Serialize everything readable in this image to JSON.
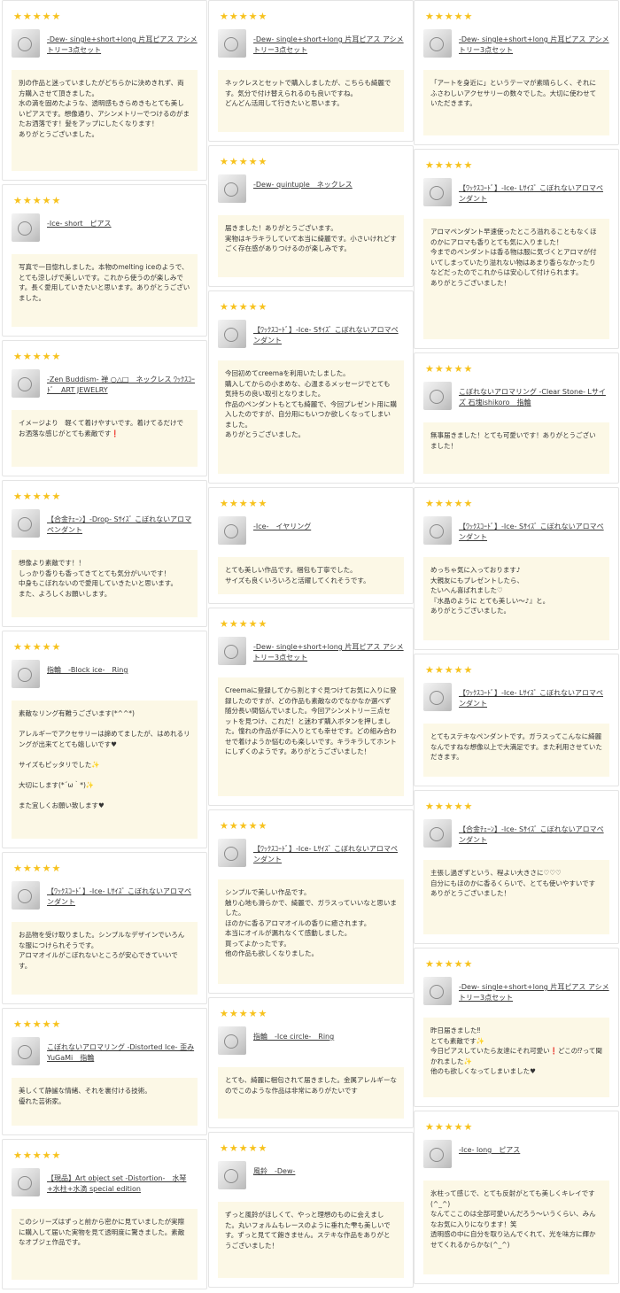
{
  "columns": [
    [
      {
        "stars": "★★★★★",
        "product": "-Dew- single+short+long 片耳ピアス アシメトリー3点セット",
        "review": "別の作品と迷っていましたがどちらかに決めきれず、両方購入させて頂きました。\n水の滴を固めたような、透明感もきらめきもとても美しいピアスです。想像通り、アシンメトリーでつけるのがまたお洒落です！髪をアップにしたくなります！\nありがとうございました。"
      },
      {
        "stars": "★★★★★",
        "product": "-Ice- short　ピアス",
        "review": "写真で一目惚れしました。本物のmelting iceのようで、とても涼しげで美しいです。これから使うのが楽しみです。長く愛用していきたいと思います。ありがとうございました。"
      },
      {
        "stars": "★★★★★",
        "product": "-Zen Buddism- 禅 ○△□　ネックレス ﾜｯｸｽｺｰﾄﾞ　ART JEWELRY",
        "review": "イメージより　軽くて着けやすいです。着けてるだけで　お洒落な感じがとても素敵です❗"
      },
      {
        "stars": "★★★★★",
        "product": "【合金ﾁｪｰﾝ】-Drop- Sｻｲｽﾞ こぼれないアロマペンダント",
        "review": "想像より素敵です！！\nしっかり香りも香ってきてとても気分がいいです！\n中身もこぼれないので愛用していきたいと思います。\nまた、よろしくお願いします。"
      },
      {
        "stars": "★★★★★",
        "product": "指輪　-Block ice-　Ring",
        "review": "素敵なリング有難うございます(*^^*)\n\nアレルギーでアクセサリーは諦めてましたが、はめれるリングが出来てとても嬉しいです♥\n\nサイズもピッタリでした✨\n\n大切にします(*´ω｀*)✨\n\nまた宜しくお願い致します♥"
      },
      {
        "stars": "★★★★★",
        "product": "【ﾜｯｸｽｺｰﾄﾞ】-Ice- Lｻｲｽﾞ こぼれないアロマペンダント",
        "review": "お品物を受け取りました。シンプルなデザインでいろんな服につけられそうです。\nアロマオイルがこぼれないところが安心できていいです。"
      },
      {
        "stars": "★★★★★",
        "product": "こぼれないアロマリング -Distorted Ice- 歪みYuGaMi　指輪",
        "review": "美しくて静謐な情緒、それを裏付ける技術。\n優れた芸術家。"
      },
      {
        "stars": "★★★★★",
        "product": "【現品】Art object set -Distortion-　水琴+水柱+水滴 special edition",
        "review": "このシリーズはずっと前から密かに見ていましたが実際に購入して届いた実物を見て透明度に驚きました。素敵なオブジェ作品です。"
      }
    ],
    [
      {
        "stars": "★★★★★",
        "product": "-Dew- single+short+long 片耳ピアス アシメトリー3点セット",
        "review": "ネックレスとセットで購入しましたが、こちらも綺麗です。気分で付け替えられるのも良いですね。\nどんどん活用して行きたいと思います。"
      },
      {
        "stars": "★★★★★",
        "product": "-Dew- quintuple　ネックレス",
        "review": "届きました！ありがとうございます。\n実物はキラキラしていて本当に綺麗です。小さいけれどすごく存在感がありつけるのが楽しみです。"
      },
      {
        "stars": "★★★★★",
        "product": "【ﾜｯｸｽｺｰﾄﾞ】-Ice- Sｻｲｽﾞ こぼれないアロマペンダント",
        "review": "今回初めてcreemaを利用いたしました。\n購入してからの小まめな、心温まるメッセージでとても気持ちの良い取引となりました。\n作品のペンダントもとても綺麗で、今回プレゼント用に購入したのですが、自分用にもいつか欲しくなってしまいました。\nありがとうございました。"
      },
      {
        "stars": "★★★★★",
        "product": "-Ice-　イヤリング",
        "review": "とても美しい作品です。梱包も丁寧でした。\nサイズも良くいろいろと活躍してくれそうです。"
      },
      {
        "stars": "★★★★★",
        "product": "-Dew- single+short+long 片耳ピアス アシメトリー3点セット",
        "review": "Creemaに登録してから割とすぐ見つけてお気に入りに登録したのですが、どの作品も素敵なのでなかなか選べず随分長い間悩んでいました。今回アシンメトリー三点セットを見つけ、これだ！と迷わず購入ボタンを押しました。憧れの作品が手に入りとても幸せです。どの組み合わせで着けようか悩むのも楽しいです。キラキラしてホントにしずくのようです。ありがとうございました！"
      },
      {
        "stars": "★★★★★",
        "product": "【ﾜｯｸｽｺｰﾄﾞ】-Ice- Lｻｲｽﾞ こぼれないアロマペンダント",
        "review": "シンプルで美しい作品です。\n触り心地も滑らかで、綺麗で、ガラスっていいなと思いました。\nほのかに香るアロマオイルの香りに癒されます。\n本当にオイルが漏れなくて感動しました。\n買ってよかったです。\n他の作品も欲しくなりました。"
      },
      {
        "stars": "★★★★★",
        "product": "指輪　-Ice circle-　Ring",
        "review": "とても、綺麗に梱包されて届きました。金属アレルギーなのでこのような作品は非常にありがたいです"
      },
      {
        "stars": "★★★★★",
        "product": "風鈴　-Dew-",
        "review": "ずっと風鈴がほしくて、やっと理想のものに会えました。丸いフォルムもレースのように垂れた雫も美しいです。ずっと見てて飽きません。ステキな作品をありがとうございました！"
      }
    ],
    [
      {
        "stars": "★★★★★",
        "product": "-Dew- single+short+long 片耳ピアス アシメトリー3点セット",
        "review": "「アートを身近に」というテーマが素晴らしく、それにふさわしいアクセサリーの数々でした。大切に使わせていただきます。"
      },
      {
        "stars": "★★★★★",
        "product": "【ﾜｯｸｽｺｰﾄﾞ】-Ice- Lｻｲｽﾞ こぼれないアロマペンダント",
        "review": "アロマペンダント早速使ったところ溢れることもなくほのかにアロマも香りとても気に入りました！\n今までのペンダントは香る物は服に気づくとアロマが付いてしまっていたり溢れない物はあまり香らなかったりなどだったのでこれからは安心して付けられます。\nありがとうございました！"
      },
      {
        "stars": "★★★★★",
        "product": "こぼれないアロマリング -Clear Stone- Lサイズ 石塊ishikoro　指輪",
        "review": "無事届きました！とても可愛いです！ありがとうございました！"
      },
      {
        "stars": "★★★★★",
        "product": "【ﾜｯｸｽｺｰﾄﾞ】-Ice- Sｻｲｽﾞ こぼれないアロマペンダント",
        "review": "めっちゃ気に入っております♪\n大親友にもプレゼントしたら、\nたいへん喜ばれました♡\n『水晶のように とても美しい〜♪』と。\nありがとうございました。"
      },
      {
        "stars": "★★★★★",
        "product": "【ﾜｯｸｽｺｰﾄﾞ】-Ice- Lｻｲｽﾞ こぼれないアロマペンダント",
        "review": "とてもステキなペンダントです。ガラスってこんなに綺麗なんですねな想像以上で大満足です。また利用させていただきます。"
      },
      {
        "stars": "★★★★★",
        "product": "【合金ﾁｪｰﾝ】-Ice- Sｻｲｽﾞ こぼれないアロマペンダント",
        "review": "主張し過ぎずという、程よい大きさに♡♡♡\n自分にもほのかに香るくらいで、とても使いやすいです\nありがとうございました！"
      },
      {
        "stars": "★★★★★",
        "product": "-Dew- single+short+long 片耳ピアス アシメトリー3点セット",
        "review": "昨日届きました‼\nとても素敵です✨\n今日ピアスしていたら友達にそれ可愛い❗どこの⁉って聞かれました✨\n他のも欲しくなってしまいました♥"
      },
      {
        "stars": "★★★★★",
        "product": "-Ice- long　ピアス",
        "review": "氷柱って感じで、とても反射がとても美しくキレイです(^_^)\nなんてここのは全部可愛いんだろう〜いうくらい、みんなお気に入りになります！笑\n透明感の中に自分を取り込んでくれて、光を味方に輝かせてくれるからかな(^_^)"
      }
    ]
  ]
}
